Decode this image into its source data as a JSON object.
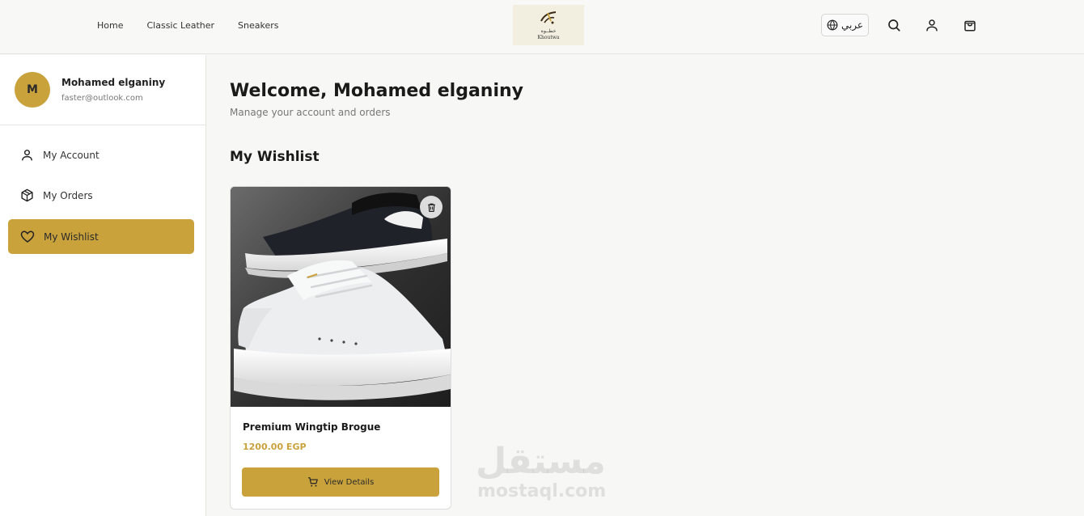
{
  "header": {
    "nav": [
      "Home",
      "Classic Leather",
      "Sneakers"
    ],
    "logo": {
      "ar": "خطــوة",
      "en": "Khoutwa"
    },
    "language_label": "عربي",
    "icons": [
      "globe-icon",
      "search-icon",
      "user-icon",
      "shopping-bag-icon"
    ]
  },
  "sidebar": {
    "avatar_initial": "M",
    "user_name": "Mohamed elganiny",
    "user_email": "faster@outlook.com",
    "items": [
      {
        "label": "My Account",
        "icon": "user-icon"
      },
      {
        "label": "My Orders",
        "icon": "package-icon"
      },
      {
        "label": "My Wishlist",
        "icon": "heart-icon",
        "active": true
      }
    ]
  },
  "main": {
    "welcome": "Welcome, Mohamed elganiny",
    "subtitle": "Manage your account and orders",
    "section_title": "My Wishlist",
    "wishlist": [
      {
        "name": "Premium Wingtip Brogue",
        "price": "1200.00 EGP",
        "button_label": "View Details"
      }
    ]
  },
  "watermark": {
    "ar": "مستقل",
    "en": "mostaql.com"
  },
  "colors": {
    "accent": "#c9a23c",
    "background": "#f7f7f5",
    "text": "#1d1d1d"
  }
}
